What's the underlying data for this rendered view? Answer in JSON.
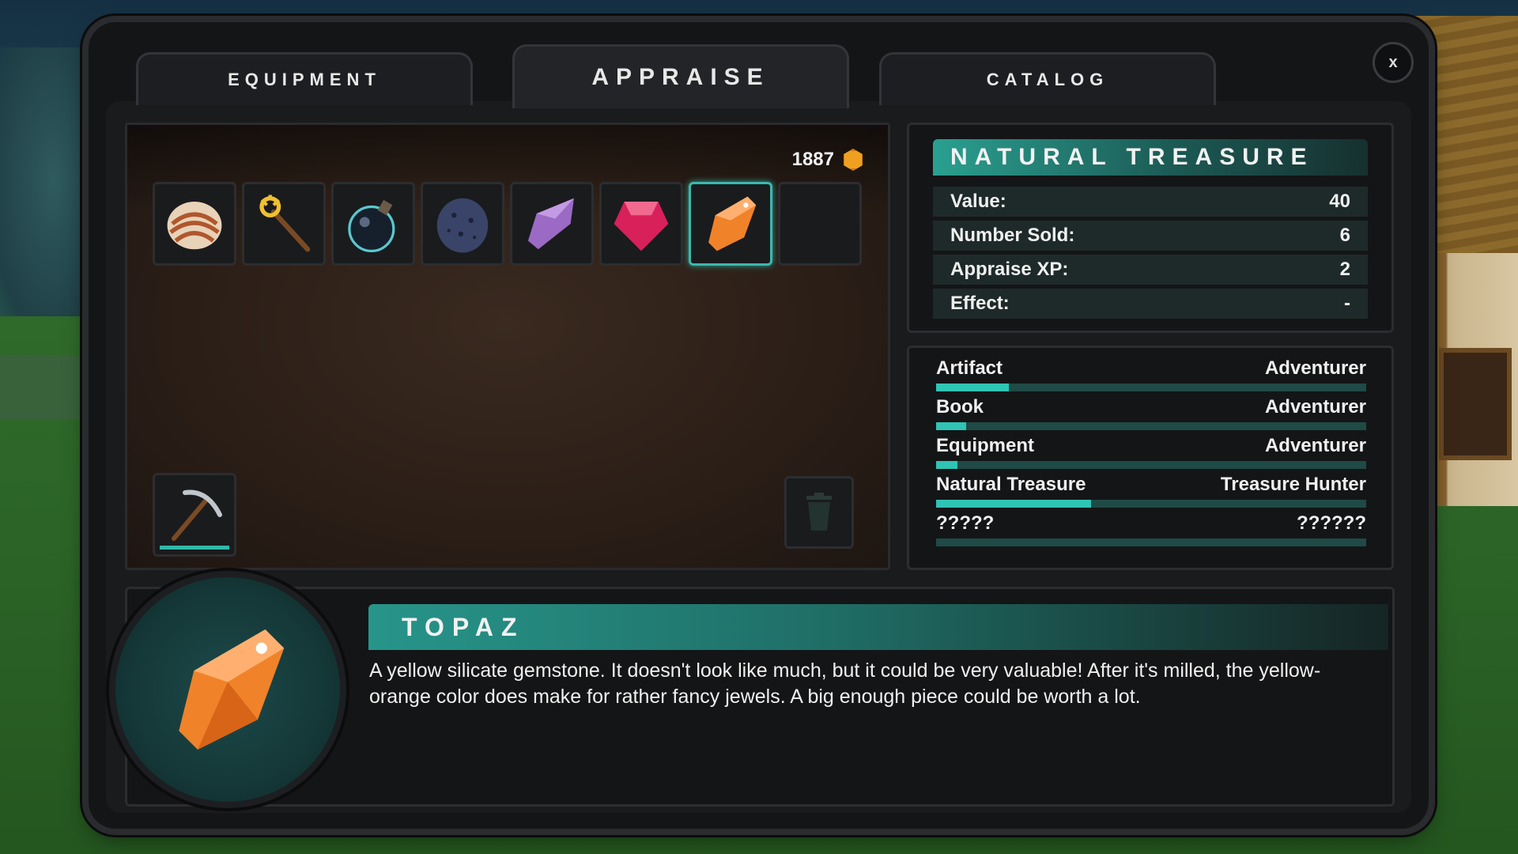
{
  "tabs": {
    "equipment": "EQUIPMENT",
    "appraise": "APPRAISE",
    "catalog": "CATALOG",
    "active": "appraise"
  },
  "close_label": "x",
  "inventory": {
    "gold": "1887",
    "gold_icon": "gold-hexagon-coin-icon",
    "slots": [
      {
        "item": "shell-icon"
      },
      {
        "item": "golden-scepter-icon"
      },
      {
        "item": "bomb-icon"
      },
      {
        "item": "dark-stone-egg-icon"
      },
      {
        "item": "purple-crystal-icon"
      },
      {
        "item": "ruby-icon"
      },
      {
        "item": "topaz-icon",
        "selected": true
      },
      {
        "item": null
      }
    ],
    "tool_slot": "pickaxe-icon",
    "trash_slot": "trash-can-icon"
  },
  "category": {
    "title": "NATURAL TREASURE",
    "stats": [
      {
        "label": "Value:",
        "value": "40"
      },
      {
        "label": "Number Sold:",
        "value": "6"
      },
      {
        "label": "Appraise XP:",
        "value": "2"
      },
      {
        "label": "Effect:",
        "value": "-"
      }
    ]
  },
  "mastery": [
    {
      "category": "Artifact",
      "rank": "Adventurer",
      "progress": 0.17
    },
    {
      "category": "Book",
      "rank": "Adventurer",
      "progress": 0.07
    },
    {
      "category": "Equipment",
      "rank": "Adventurer",
      "progress": 0.05
    },
    {
      "category": "Natural Treasure",
      "rank": "Treasure Hunter",
      "progress": 0.36
    },
    {
      "category": "?????",
      "rank": "??????",
      "progress": 0
    }
  ],
  "selected_item": {
    "name": "TOPAZ",
    "description": "A yellow silicate gemstone. It doesn't look like much, but it could be very valuable! After it's milled, the yellow-orange color does make for rather fancy jewels. A big enough piece could be worth a lot."
  },
  "colors": {
    "accent": "#2fc4b4",
    "gold": "#f0a020"
  }
}
